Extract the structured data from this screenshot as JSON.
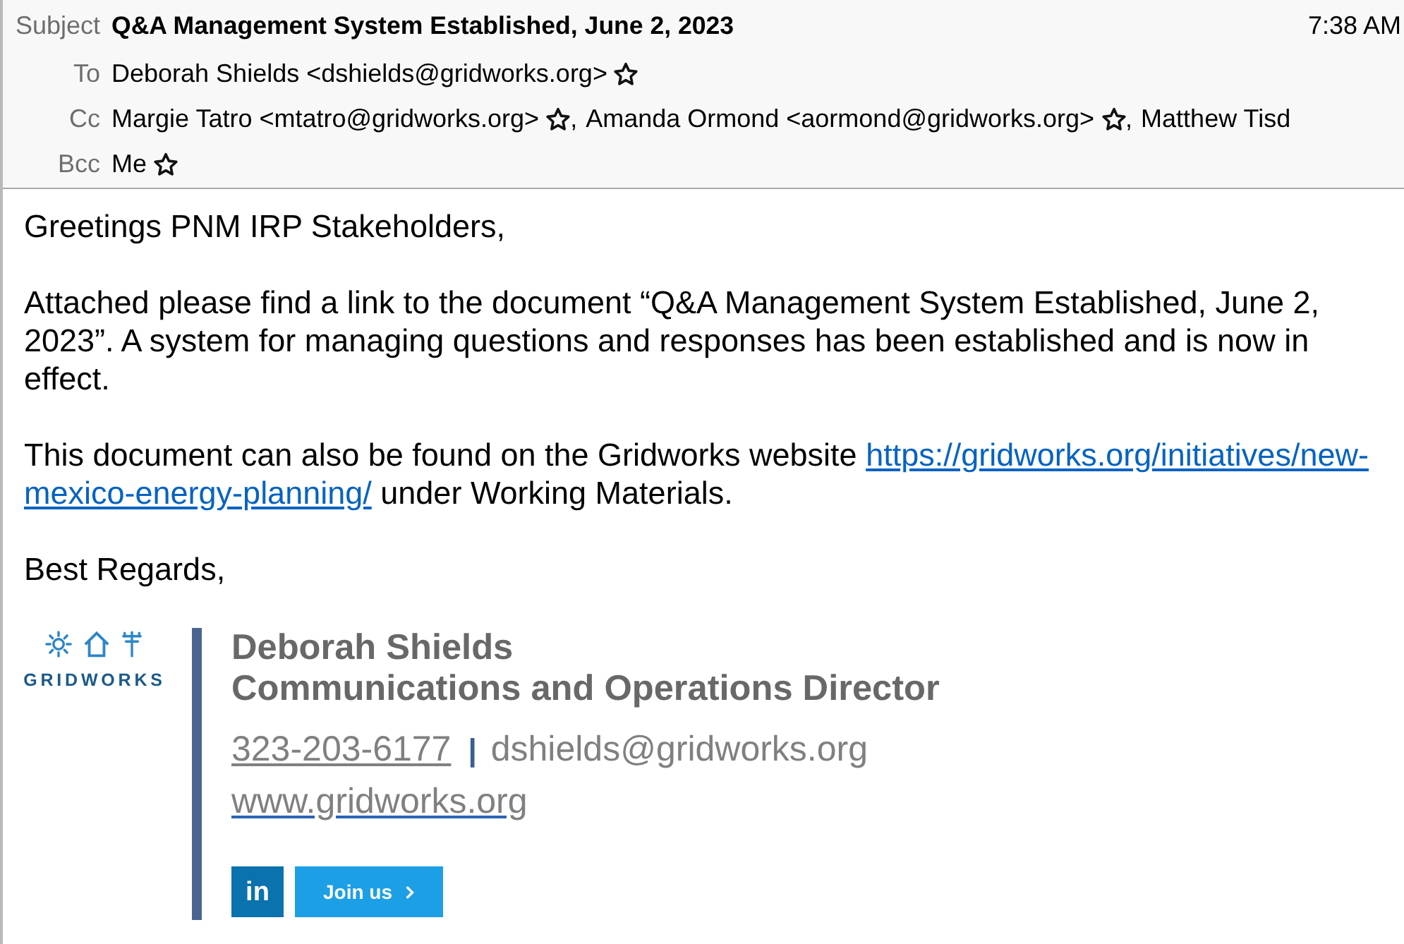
{
  "header": {
    "subject": {
      "label": "Subject",
      "text": "Q&A Management System Established, June 2, 2023"
    },
    "time": "7:38 AM",
    "fields": [
      {
        "label": "To",
        "recipients": [
          {
            "kind": "contact",
            "text": "Deborah Shields <dshields@gridworks.org>"
          }
        ]
      },
      {
        "label": "Cc",
        "recipients": [
          {
            "kind": "contact",
            "text": "Margie Tatro <mtatro@gridworks.org>",
            "separator": ","
          },
          {
            "kind": "contact",
            "text": "Amanda Ormond <aormond@gridworks.org>",
            "separator": ","
          },
          {
            "kind": "cut",
            "text": "Matthew Tisd"
          }
        ]
      },
      {
        "label": "Bcc",
        "recipients": [
          {
            "kind": "contact",
            "text": "Me"
          }
        ]
      }
    ]
  },
  "body": {
    "paragraphs": [
      [
        {
          "kind": "text",
          "text": "Greetings PNM IRP Stakeholders,"
        }
      ],
      [
        {
          "kind": "text",
          "text": "Attached please find a link to the document “Q&A Management System Established, June 2, 2023”. A system for managing questions and responses has been established and is now in effect."
        }
      ],
      [
        {
          "kind": "text",
          "text": "This document can also be found on the Gridworks website "
        },
        {
          "kind": "link",
          "text": "https://gridworks.org/initiatives/new-"
        },
        {
          "kind": "link",
          "text": "mexico-energy-planning/"
        },
        {
          "kind": "text",
          "text": " under Working Materials."
        }
      ],
      [
        {
          "kind": "text",
          "text": "Best Regards,"
        }
      ]
    ]
  },
  "signature": {
    "logo_text": "GRIDWORKS",
    "name": "Deborah Shields",
    "title": "Communications and Operations Director",
    "phone": "323-203-6177",
    "divider": "|",
    "email": "dshields@gridworks.org",
    "website": "www.gridworks.org",
    "social_label": "in",
    "join_button": "Join us"
  }
}
